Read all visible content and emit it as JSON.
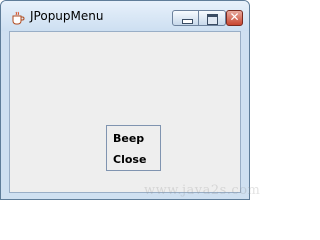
{
  "window": {
    "title": "JPopupMenu",
    "app_icon": "java-cup-icon",
    "controls": {
      "minimize_icon": "minimize-icon",
      "maximize_icon": "maximize-icon",
      "close_icon": "close-icon",
      "close_glyph": "✕",
      "close_color": "#c8452f"
    }
  },
  "popup_menu": {
    "items": [
      {
        "label": "Beep"
      },
      {
        "label": "Close"
      }
    ]
  },
  "watermark": {
    "text": "www.java2s.com"
  }
}
